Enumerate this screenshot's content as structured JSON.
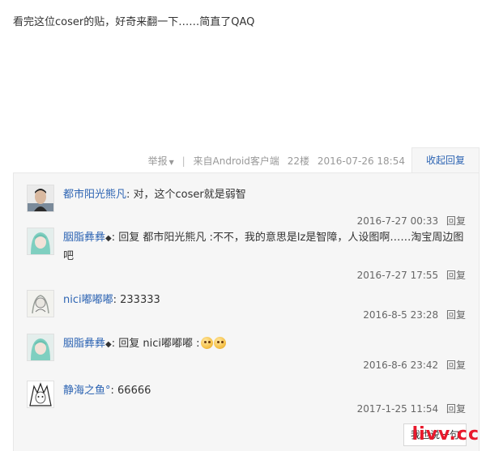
{
  "post": {
    "text": "看完这位coser的贴，好奇来翻一下……简直了QAQ"
  },
  "meta": {
    "report": "举报",
    "source": "来自Android客户端",
    "floor": "22楼",
    "time": "2016-07-26 18:54",
    "collapse": "收起回复"
  },
  "replies": [
    {
      "user": "都市阳光熊凡",
      "content": ": 对，这个coser就是弱智",
      "time": "2016-7-27 00:33",
      "reply_label": "回复"
    },
    {
      "user": "胭脂彝彝",
      "content_prefix": ": 回复 ",
      "quote_user": "都市阳光熊凡",
      "content": " :不不，我的意思是lz是智障，人设图啊……淘宝周边图吧",
      "time": "2016-7-27 17:55",
      "reply_label": "回复"
    },
    {
      "user": "nici嘟嘟嘟",
      "content": ": 233333",
      "time": "2016-8-5 23:28",
      "reply_label": "回复"
    },
    {
      "user": "胭脂彝彝",
      "content_prefix": ": 回复 ",
      "quote_user": "nici嘟嘟嘟",
      "content": " :",
      "time": "2016-8-6 23:42",
      "reply_label": "回复"
    },
    {
      "user": "静海之鱼°",
      "content": ": 66666",
      "time": "2017-1-25 11:54",
      "reply_label": "回复"
    }
  ],
  "say_one_button": "我也说一句",
  "watermark": "livv.cc"
}
